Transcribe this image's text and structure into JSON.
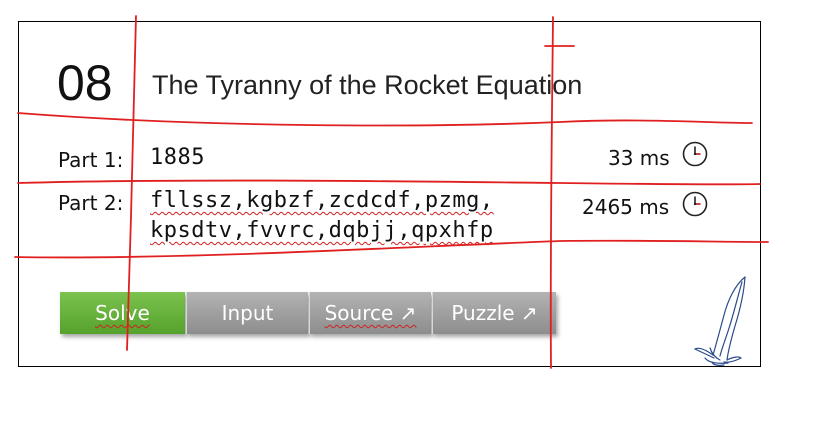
{
  "puzzle": {
    "day": "08",
    "title": "The Tyranny of the Rocket Equation"
  },
  "part1": {
    "label": "Part 1:",
    "answer": "1885",
    "time": "33 ms",
    "time_icon": "clock-icon"
  },
  "part2": {
    "label": "Part 2:",
    "answer_line1": "fllssz,kgbzf,zcdcdf,pzmg,",
    "answer_line2": "kpsdtv,fvvrc,dqbjj,qpxhfp",
    "time": "2465 ms",
    "time_icon": "clock-icon"
  },
  "buttons": {
    "solve": "Solve",
    "input": "Input",
    "source": "Source ↗",
    "puzzle": "Puzzle ↗"
  },
  "colors": {
    "solve_button": "#5fab36",
    "gray_button": "#a0a0a0",
    "annotation_red": "#e02020",
    "sketch_blue": "#2a4a8a"
  },
  "decoration": {
    "sketch": "rocket-sketch"
  }
}
